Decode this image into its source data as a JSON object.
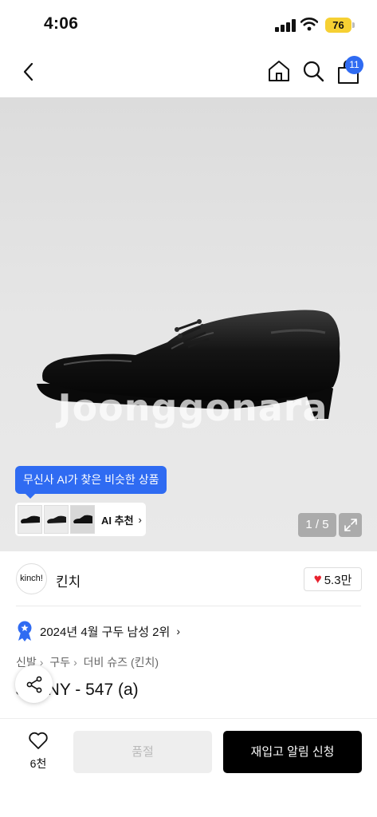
{
  "status_bar": {
    "time": "4:06",
    "battery": "76"
  },
  "header": {
    "back_icon": "chevron-left-icon",
    "home_icon": "home-icon",
    "search_icon": "search-icon",
    "cart_icon": "shopping-bag-icon",
    "cart_count": "11"
  },
  "gallery": {
    "watermark": "Joonggonara",
    "ai_tooltip": "무신사 AI가 찾은 비슷한 상품",
    "ai_reco_label": "AI 추천",
    "page_indicator": "1 / 5",
    "expand_icon": "expand-icon"
  },
  "brand": {
    "logo_text": "kinch!",
    "name": "킨치",
    "like_count": "5.3만"
  },
  "ranking": {
    "text": "2024년 4월 구두 남성 2위"
  },
  "breadcrumb": [
    "신발",
    "구두",
    "더비 슈즈 (킨치)"
  ],
  "product": {
    "title": "JENNY - 547 (a)"
  },
  "bottom_bar": {
    "wish_count": "6천",
    "soldout_label": "품절",
    "restock_label": "재입고 알림 신청"
  },
  "colors": {
    "accent_blue": "#2f6bf2",
    "heart_red": "#e8222e",
    "battery_yellow": "#f6d033"
  }
}
